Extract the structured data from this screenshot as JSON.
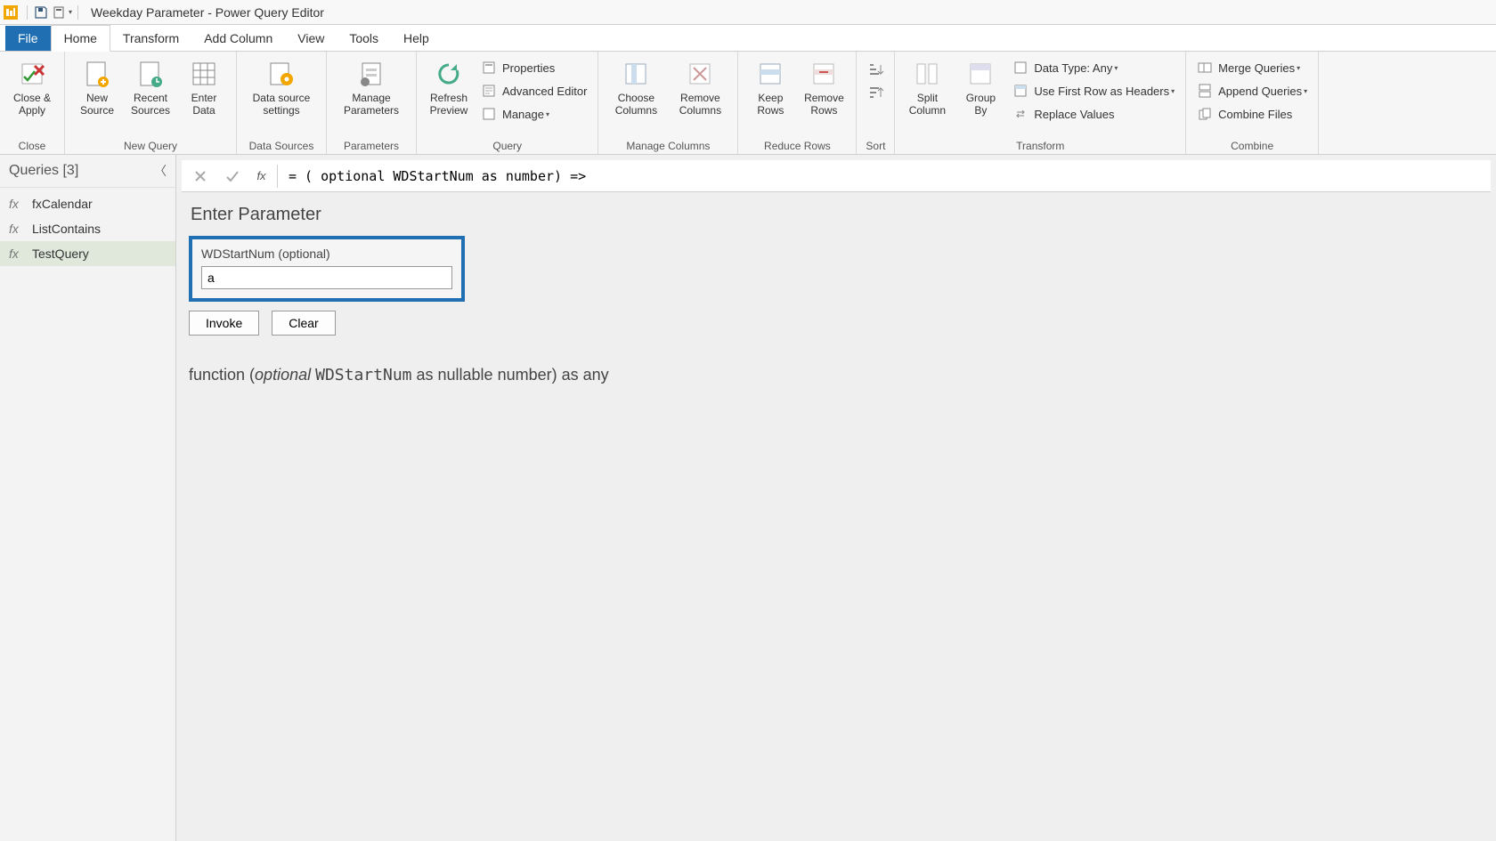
{
  "window": {
    "title": "Weekday Parameter - Power Query Editor"
  },
  "tabs": {
    "file": "File",
    "home": "Home",
    "transform": "Transform",
    "addcolumn": "Add Column",
    "view": "View",
    "tools": "Tools",
    "help": "Help"
  },
  "ribbon": {
    "close_group": "Close",
    "close_apply": "Close &\nApply",
    "newquery_group": "New Query",
    "new_source": "New\nSource",
    "recent_sources": "Recent\nSources",
    "enter_data": "Enter\nData",
    "datasources_group": "Data Sources",
    "data_source_settings": "Data source\nsettings",
    "parameters_group": "Parameters",
    "manage_parameters": "Manage\nParameters",
    "query_group": "Query",
    "refresh_preview": "Refresh\nPreview",
    "properties": "Properties",
    "advanced_editor": "Advanced Editor",
    "manage": "Manage",
    "managecols_group": "Manage Columns",
    "choose_columns": "Choose\nColumns",
    "remove_columns": "Remove\nColumns",
    "reducerows_group": "Reduce Rows",
    "keep_rows": "Keep\nRows",
    "remove_rows": "Remove\nRows",
    "sort_group": "Sort",
    "transform_group": "Transform",
    "split_column": "Split\nColumn",
    "group_by": "Group\nBy",
    "data_type": "Data Type: Any",
    "first_row_headers": "Use First Row as Headers",
    "replace_values": "Replace Values",
    "combine_group": "Combine",
    "merge_queries": "Merge Queries",
    "append_queries": "Append Queries",
    "combine_files": "Combine Files"
  },
  "sidebar": {
    "header": "Queries [3]",
    "items": [
      {
        "label": "fxCalendar"
      },
      {
        "label": "ListContains"
      },
      {
        "label": "TestQuery"
      }
    ]
  },
  "formula": "= ( optional WDStartNum as number) =>",
  "param": {
    "heading": "Enter Parameter",
    "label": "WDStartNum (optional)",
    "value": "a",
    "invoke": "Invoke",
    "clear": "Clear"
  },
  "signature": {
    "prefix": "function (",
    "optional": "optional",
    "name": "WDStartNum",
    "suffix": " as nullable number) as any"
  }
}
